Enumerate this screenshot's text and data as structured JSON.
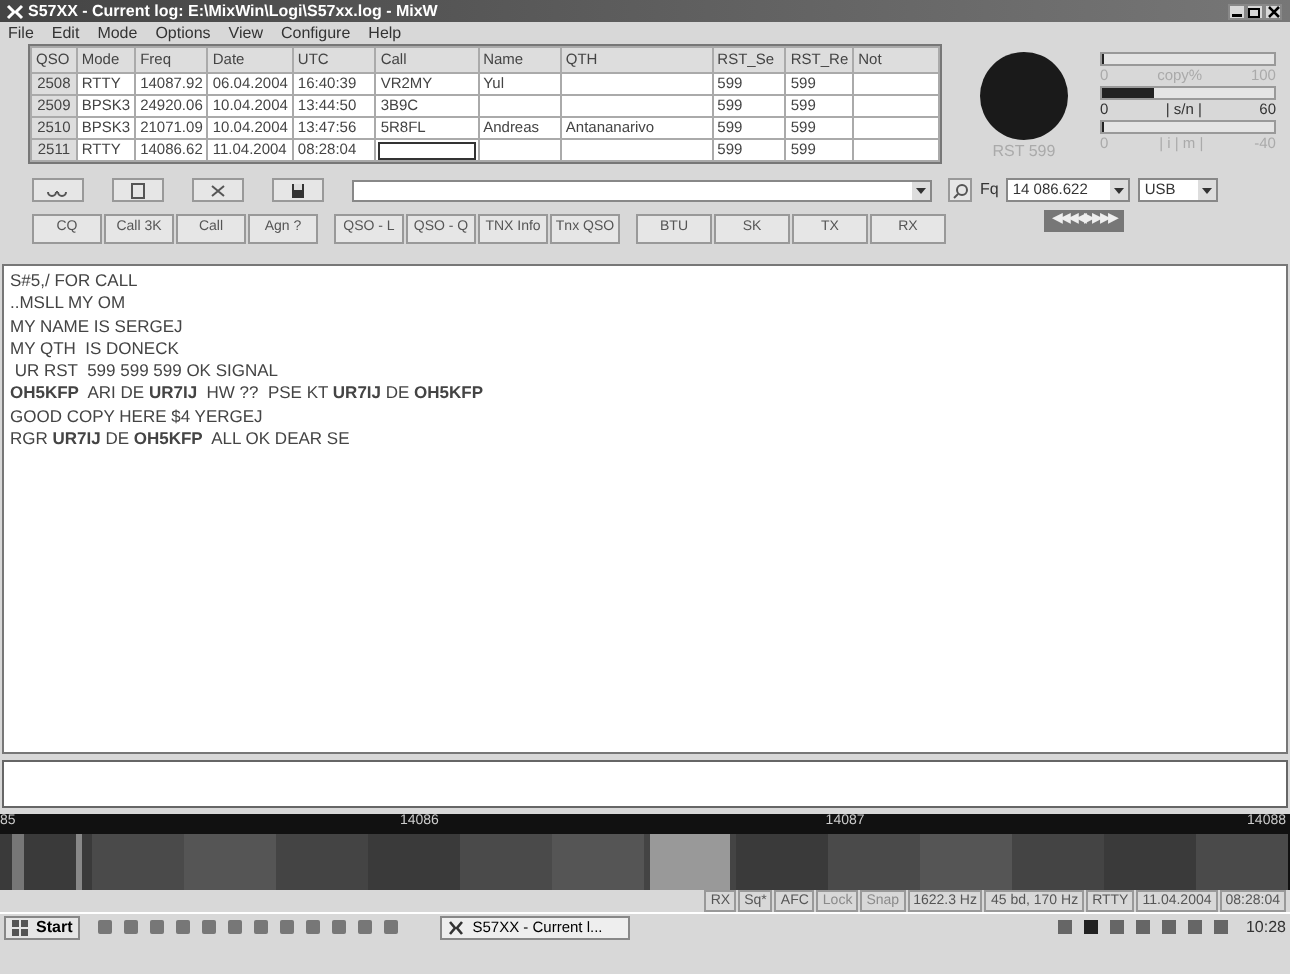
{
  "window": {
    "title": "S57XX - Current log: E:\\MixWin\\Logi\\S57xx.log - MixW"
  },
  "menu": [
    "File",
    "Edit",
    "Mode",
    "Options",
    "View",
    "Configure",
    "Help"
  ],
  "log": {
    "columns": [
      "QSO",
      "Mode",
      "Freq",
      "Date",
      "UTC",
      "Call",
      "Name",
      "QTH",
      "RST_Se",
      "RST_Re",
      "Not"
    ],
    "rows": [
      {
        "current": false,
        "cells": [
          "2508",
          "RTTY",
          "14087.92",
          "06.04.2004",
          "16:40:39",
          "VR2MY",
          "Yul",
          "",
          "599",
          "599",
          ""
        ]
      },
      {
        "current": false,
        "cells": [
          "2509",
          "BPSK3",
          "24920.06",
          "10.04.2004",
          "13:44:50",
          "3B9C",
          "",
          "",
          "599",
          "599",
          ""
        ]
      },
      {
        "current": false,
        "cells": [
          "2510",
          "BPSK3",
          "21071.09",
          "10.04.2004",
          "13:47:56",
          "5R8FL",
          "Andreas",
          "Antananarivo",
          "599",
          "599",
          ""
        ]
      },
      {
        "current": true,
        "cells": [
          "2511",
          "RTTY",
          "14086.62",
          "11.04.2004",
          "08:28:04",
          "",
          "",
          "",
          "599",
          "599",
          ""
        ]
      }
    ]
  },
  "rst_label": "RST 599",
  "meters": [
    {
      "min": "0",
      "label": "copy%",
      "max": "100",
      "level": 0,
      "dimmed": true
    },
    {
      "min": "0",
      "label": "| s/n |",
      "max": "60",
      "level": 0.3,
      "dimmed": false
    },
    {
      "min": "0",
      "label": "| i | m |",
      "max": "-40",
      "level": 0,
      "dimmed": true
    }
  ],
  "macros": [
    "CQ",
    "Call 3K",
    "Call",
    "Agn ?",
    "QSO - L",
    "QSO - Q",
    "TNX Info",
    "Tnx QSO",
    "BTU",
    "SK",
    "TX",
    "RX"
  ],
  "freq": {
    "label": "Fq",
    "value": "14 086.622",
    "mode": "USB"
  },
  "tune_button": "◀◀◀◀▶▶▶▶",
  "receive_text": [
    "S#5,/ FOR CALL",
    "..MSLL MY OM",
    "MY NAME IS SERGEJ",
    "MY QTH  IS DONECK",
    " UR RST  599 599 599 OK SIGNAL",
    "**OH5KFP**  ARI DE **UR7IJ**  HW ??  PSE KT **UR7IJ** DE **OH5KFP**",
    "GOOD COPY HERE $4 YERGEJ",
    "RGR **UR7IJ** DE **OH5KFP**  ALL OK DEAR SE"
  ],
  "waterfall": {
    "scale": [
      "85",
      "14086",
      "14087",
      "14088"
    ]
  },
  "status_bar": [
    {
      "text": "RX",
      "disabled": false
    },
    {
      "text": "Sq*",
      "disabled": false
    },
    {
      "text": "AFC",
      "disabled": false
    },
    {
      "text": "Lock",
      "disabled": true
    },
    {
      "text": "Snap",
      "disabled": true
    },
    {
      "text": "1622.3 Hz",
      "disabled": false
    },
    {
      "text": "45 bd, 170 Hz",
      "disabled": false
    },
    {
      "text": "RTTY",
      "disabled": false
    },
    {
      "text": "11.04.2004",
      "disabled": false
    },
    {
      "text": "08:28:04",
      "disabled": false
    }
  ],
  "taskbar": {
    "start": "Start",
    "task": "S57XX - Current l...",
    "clock": "10:28"
  }
}
